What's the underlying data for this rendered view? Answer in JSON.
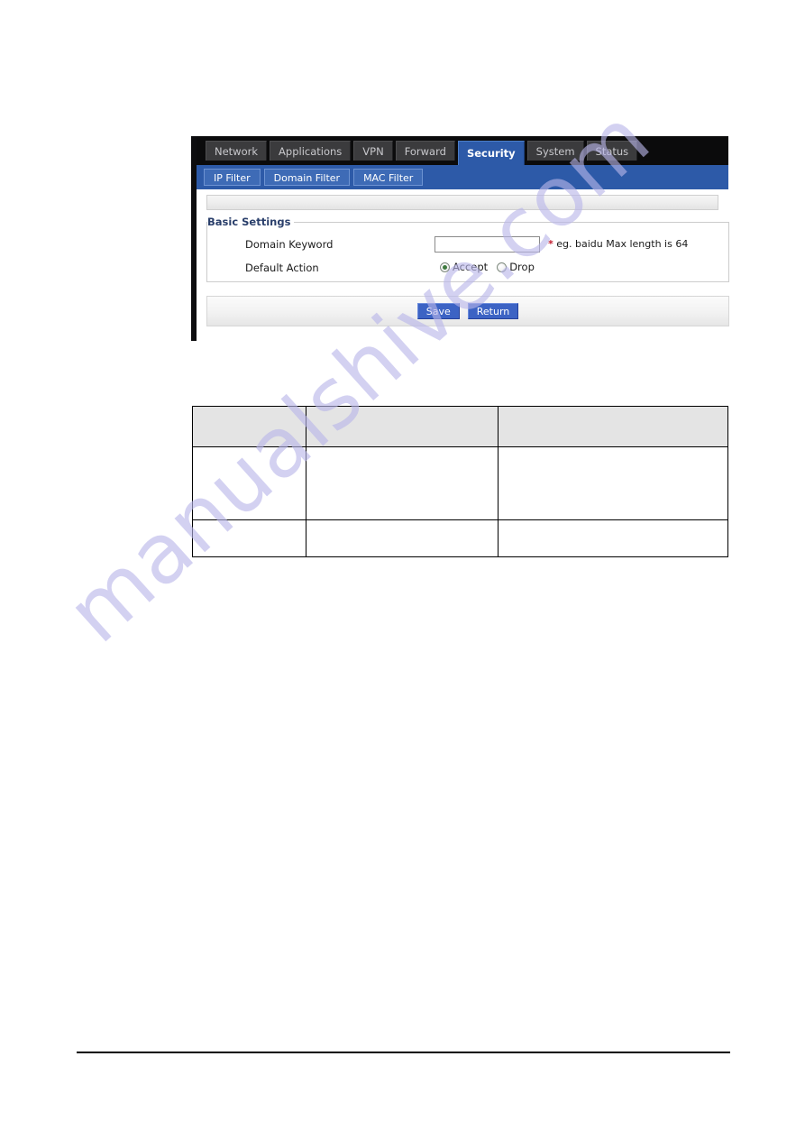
{
  "page": {
    "watermark": "manualshive.com"
  },
  "router_ui": {
    "nav_tabs": [
      {
        "label": "Network",
        "active": false
      },
      {
        "label": "Applications",
        "active": false
      },
      {
        "label": "VPN",
        "active": false
      },
      {
        "label": "Forward",
        "active": false
      },
      {
        "label": "Security",
        "active": true
      },
      {
        "label": "System",
        "active": false
      },
      {
        "label": "Status",
        "active": false
      }
    ],
    "sub_tabs": [
      {
        "label": "IP Filter",
        "active": false
      },
      {
        "label": "Domain Filter",
        "active": false
      },
      {
        "label": "MAC Filter",
        "active": false
      }
    ],
    "titlebar_text": "",
    "fieldset": {
      "legend": "Basic Settings",
      "rows": [
        {
          "label": "Domain Keyword",
          "input_value": "",
          "input_placeholder": "",
          "hint_star": "*",
          "hint_text": " eg. baidu Max length is 64"
        },
        {
          "label": "Default Action",
          "options": [
            {
              "label": "Accept",
              "checked": true
            },
            {
              "label": "Drop",
              "checked": false
            }
          ]
        }
      ]
    },
    "buttons": {
      "save_label": "Save",
      "return_label": "Return"
    },
    "colors": {
      "navbar_black": "#0b0b0c",
      "tab_inactive": "#3b3b3d",
      "accent_blue": "#2d5aa8",
      "subtab_blue": "#3e6bb6",
      "button_blue": "#3c63c4",
      "legend_text": "#2a3f6b",
      "required_star": "#c0182b",
      "radio_dot": "#3e7a3e"
    }
  },
  "table": {
    "columns": [
      "",
      "",
      ""
    ],
    "headers": [
      "",
      "",
      ""
    ],
    "rows": [
      [
        "",
        "",
        ""
      ],
      [
        "",
        "",
        ""
      ]
    ]
  }
}
